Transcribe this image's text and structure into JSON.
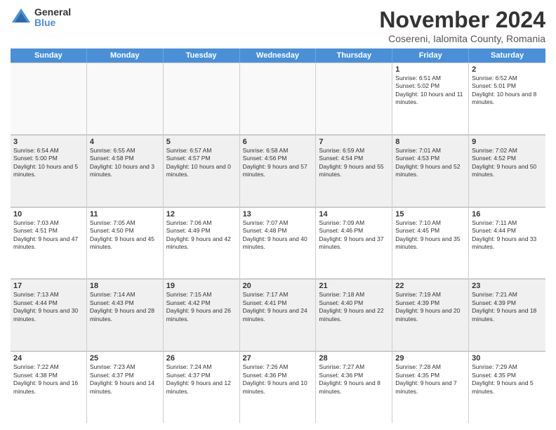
{
  "logo": {
    "general": "General",
    "blue": "Blue"
  },
  "title": "November 2024",
  "subtitle": "Cosereni, Ialomita County, Romania",
  "header": {
    "days": [
      "Sunday",
      "Monday",
      "Tuesday",
      "Wednesday",
      "Thursday",
      "Friday",
      "Saturday"
    ]
  },
  "weeks": [
    [
      {
        "day": "",
        "info": ""
      },
      {
        "day": "",
        "info": ""
      },
      {
        "day": "",
        "info": ""
      },
      {
        "day": "",
        "info": ""
      },
      {
        "day": "",
        "info": ""
      },
      {
        "day": "1",
        "info": "Sunrise: 6:51 AM\nSunset: 5:02 PM\nDaylight: 10 hours and 11 minutes."
      },
      {
        "day": "2",
        "info": "Sunrise: 6:52 AM\nSunset: 5:01 PM\nDaylight: 10 hours and 8 minutes."
      }
    ],
    [
      {
        "day": "3",
        "info": "Sunrise: 6:54 AM\nSunset: 5:00 PM\nDaylight: 10 hours and 5 minutes."
      },
      {
        "day": "4",
        "info": "Sunrise: 6:55 AM\nSunset: 4:58 PM\nDaylight: 10 hours and 3 minutes."
      },
      {
        "day": "5",
        "info": "Sunrise: 6:57 AM\nSunset: 4:57 PM\nDaylight: 10 hours and 0 minutes."
      },
      {
        "day": "6",
        "info": "Sunrise: 6:58 AM\nSunset: 4:56 PM\nDaylight: 9 hours and 57 minutes."
      },
      {
        "day": "7",
        "info": "Sunrise: 6:59 AM\nSunset: 4:54 PM\nDaylight: 9 hours and 55 minutes."
      },
      {
        "day": "8",
        "info": "Sunrise: 7:01 AM\nSunset: 4:53 PM\nDaylight: 9 hours and 52 minutes."
      },
      {
        "day": "9",
        "info": "Sunrise: 7:02 AM\nSunset: 4:52 PM\nDaylight: 9 hours and 50 minutes."
      }
    ],
    [
      {
        "day": "10",
        "info": "Sunrise: 7:03 AM\nSunset: 4:51 PM\nDaylight: 9 hours and 47 minutes."
      },
      {
        "day": "11",
        "info": "Sunrise: 7:05 AM\nSunset: 4:50 PM\nDaylight: 9 hours and 45 minutes."
      },
      {
        "day": "12",
        "info": "Sunrise: 7:06 AM\nSunset: 4:49 PM\nDaylight: 9 hours and 42 minutes."
      },
      {
        "day": "13",
        "info": "Sunrise: 7:07 AM\nSunset: 4:48 PM\nDaylight: 9 hours and 40 minutes."
      },
      {
        "day": "14",
        "info": "Sunrise: 7:09 AM\nSunset: 4:46 PM\nDaylight: 9 hours and 37 minutes."
      },
      {
        "day": "15",
        "info": "Sunrise: 7:10 AM\nSunset: 4:45 PM\nDaylight: 9 hours and 35 minutes."
      },
      {
        "day": "16",
        "info": "Sunrise: 7:11 AM\nSunset: 4:44 PM\nDaylight: 9 hours and 33 minutes."
      }
    ],
    [
      {
        "day": "17",
        "info": "Sunrise: 7:13 AM\nSunset: 4:44 PM\nDaylight: 9 hours and 30 minutes."
      },
      {
        "day": "18",
        "info": "Sunrise: 7:14 AM\nSunset: 4:43 PM\nDaylight: 9 hours and 28 minutes."
      },
      {
        "day": "19",
        "info": "Sunrise: 7:15 AM\nSunset: 4:42 PM\nDaylight: 9 hours and 26 minutes."
      },
      {
        "day": "20",
        "info": "Sunrise: 7:17 AM\nSunset: 4:41 PM\nDaylight: 9 hours and 24 minutes."
      },
      {
        "day": "21",
        "info": "Sunrise: 7:18 AM\nSunset: 4:40 PM\nDaylight: 9 hours and 22 minutes."
      },
      {
        "day": "22",
        "info": "Sunrise: 7:19 AM\nSunset: 4:39 PM\nDaylight: 9 hours and 20 minutes."
      },
      {
        "day": "23",
        "info": "Sunrise: 7:21 AM\nSunset: 4:39 PM\nDaylight: 9 hours and 18 minutes."
      }
    ],
    [
      {
        "day": "24",
        "info": "Sunrise: 7:22 AM\nSunset: 4:38 PM\nDaylight: 9 hours and 16 minutes."
      },
      {
        "day": "25",
        "info": "Sunrise: 7:23 AM\nSunset: 4:37 PM\nDaylight: 9 hours and 14 minutes."
      },
      {
        "day": "26",
        "info": "Sunrise: 7:24 AM\nSunset: 4:37 PM\nDaylight: 9 hours and 12 minutes."
      },
      {
        "day": "27",
        "info": "Sunrise: 7:26 AM\nSunset: 4:36 PM\nDaylight: 9 hours and 10 minutes."
      },
      {
        "day": "28",
        "info": "Sunrise: 7:27 AM\nSunset: 4:36 PM\nDaylight: 9 hours and 8 minutes."
      },
      {
        "day": "29",
        "info": "Sunrise: 7:28 AM\nSunset: 4:35 PM\nDaylight: 9 hours and 7 minutes."
      },
      {
        "day": "30",
        "info": "Sunrise: 7:29 AM\nSunset: 4:35 PM\nDaylight: 9 hours and 5 minutes."
      }
    ]
  ]
}
